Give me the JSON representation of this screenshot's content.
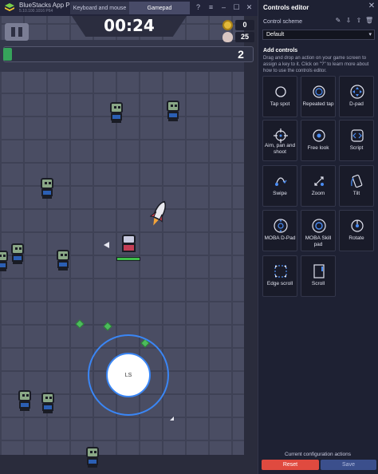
{
  "window": {
    "app_title": "BlueStacks App Player",
    "app_subtitle": "5.10.100.1016 P64",
    "tabs": [
      {
        "label": "Keyboard and mouse",
        "active": false
      },
      {
        "label": "Gamepad",
        "active": true
      }
    ],
    "controls": [
      "help-icon",
      "menu-icon",
      "minimize-icon",
      "maximize-icon",
      "close-icon"
    ]
  },
  "game": {
    "timer": "00:24",
    "coins": "0",
    "kills": "25",
    "level": "2",
    "xp_fraction": 0.02,
    "joystick_label": "LS"
  },
  "panel": {
    "title": "Controls editor",
    "scheme_label": "Control scheme",
    "scheme_icons": [
      "new-scheme-icon",
      "import-icon",
      "export-icon",
      "delete-icon"
    ],
    "scheme_value": "Default",
    "add_title": "Add controls",
    "add_desc": "Drag and drop an action on your game screen to assign a key to it. Click on \"?\" to learn more about how to use the controls editor.",
    "controls": [
      {
        "label": "Tap spot",
        "icon": "tap-spot-icon"
      },
      {
        "label": "Repeated tap",
        "icon": "repeated-tap-icon"
      },
      {
        "label": "D-pad",
        "icon": "dpad-icon"
      },
      {
        "label": "Aim, pan and shoot",
        "icon": "aim-icon"
      },
      {
        "label": "Free look",
        "icon": "free-look-icon"
      },
      {
        "label": "Script",
        "icon": "script-icon"
      },
      {
        "label": "Swipe",
        "icon": "swipe-icon"
      },
      {
        "label": "Zoom",
        "icon": "zoom-icon"
      },
      {
        "label": "Tilt",
        "icon": "tilt-icon"
      },
      {
        "label": "MOBA D-Pad",
        "icon": "moba-dpad-icon"
      },
      {
        "label": "MOBA Skill pad",
        "icon": "moba-skill-pad-icon"
      },
      {
        "label": "Rotate",
        "icon": "rotate-icon"
      },
      {
        "label": "Edge scroll",
        "icon": "edge-scroll-icon"
      },
      {
        "label": "Scroll",
        "icon": "scroll-icon"
      }
    ],
    "config_actions_label": "Current configuration actions",
    "reset_label": "Reset",
    "save_label": "Save"
  }
}
